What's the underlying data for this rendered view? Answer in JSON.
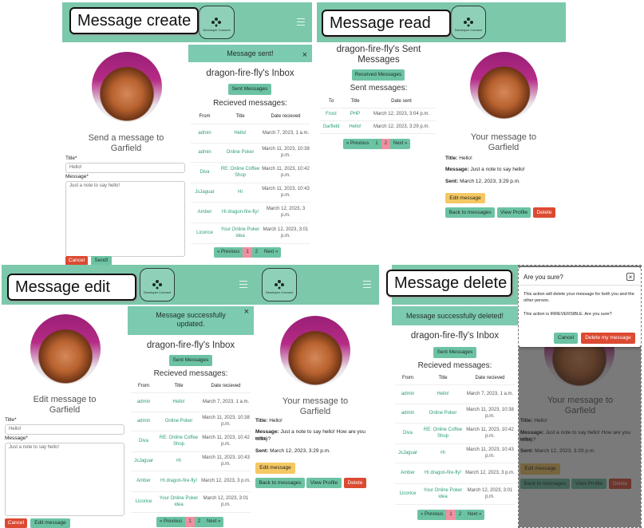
{
  "labels": {
    "create": "Message create",
    "read": "Message read",
    "edit": "Message edit",
    "delete": "Message delete"
  },
  "brand": {
    "logo_text": "Developer Connect"
  },
  "colors": {
    "nav": "#7cc8ab",
    "accent": "#6cc3a4",
    "danger": "#dc4a32",
    "warning": "#f6c863",
    "link": "#2a9d7a"
  },
  "create": {
    "heading": "Send a message to\nGarfield",
    "title_label": "Title*",
    "title_value": "Hello!",
    "message_label": "Message*",
    "message_value": "Just a note to say hello!",
    "cancel": "Cancel",
    "send": "Send!"
  },
  "inbox_sent_alert": "Message sent!",
  "inbox": {
    "title": "dragon-fire-fly's Inbox",
    "sent_button": "Sent Messages",
    "received_heading": "Recieved messages:",
    "headers": [
      "From",
      "Title",
      "Date recieved"
    ],
    "rows": [
      [
        "admin",
        "Hello!",
        "March 7, 2023, 1 a.m."
      ],
      [
        "admin",
        "Online Poker",
        "March 11, 2023, 10:38 p.m."
      ],
      [
        "Diva",
        "RE: Online Coffee Shop",
        "March 11, 2023, 10:42 p.m."
      ],
      [
        "JsJaguar",
        "Hi",
        "March 11, 2023, 10:43 p.m."
      ],
      [
        "Amber",
        "Hi dragon-fire-fly!",
        "March 12, 2023, 3 p.m."
      ],
      [
        "Licorice",
        "Your Online Poker idea",
        "March 12, 2023, 3:01 p.m."
      ]
    ],
    "pagination": [
      "« Previous",
      "1",
      "2",
      "Next »"
    ]
  },
  "sent": {
    "title": "dragon-fire-fly's Sent Messages",
    "received_button": "Received Messages",
    "sent_heading": "Sent messages:",
    "headers": [
      "To",
      "Title",
      "Date sent"
    ],
    "rows": [
      [
        "Frost",
        "PHP",
        "March 12, 2023, 3:04 p.m."
      ],
      [
        "Garfield",
        "Hello!",
        "March 12, 2023, 3:29 p.m."
      ]
    ],
    "pagination": [
      "« Previous",
      "1",
      "2",
      "Next »"
    ]
  },
  "read": {
    "heading": "Your message to\nGarfield",
    "title_label": "Title:",
    "title_value": "Hello!",
    "message_label": "Message:",
    "message_value": "Just a note to say hello!",
    "sent_label": "Sent:",
    "sent_value": "March 12, 2023, 3:29 p.m.",
    "edit": "Edit message",
    "back": "Back to messages",
    "profile": "View Profile",
    "delete": "Delete"
  },
  "edit": {
    "heading": "Edit message to\nGarfield",
    "title_label": "Title*",
    "title_value": "Hello!",
    "message_label": "Message*",
    "message_value": "Just a note to say hello!",
    "cancel": "Cancel",
    "submit": "Edit message"
  },
  "updated_alert": "Message successfully\nupdated.",
  "read_edited": {
    "message_value": "Just a note to say hello! How are you today?",
    "edited": "edited"
  },
  "deleted_alert": "Message successfully deleted!",
  "modal": {
    "title": "Are you sure?",
    "close": "×",
    "line1": "This action will delete your message for both you and the other person.",
    "line2": "This action is IRREVERSIBLE. Are you sure?",
    "cancel": "Cancel",
    "confirm": "Delete my message"
  }
}
